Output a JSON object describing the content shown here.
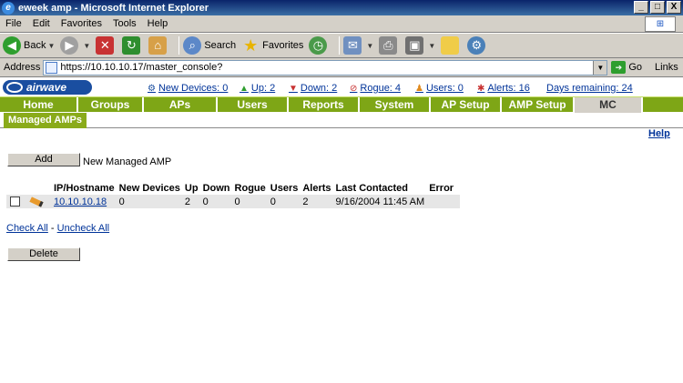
{
  "window": {
    "title": "eweek amp - Microsoft Internet Explorer",
    "controls": [
      "_",
      "□",
      "X"
    ]
  },
  "menu": [
    "File",
    "Edit",
    "Favorites",
    "Tools",
    "Help"
  ],
  "toolbar": {
    "back": "Back",
    "search": "Search",
    "favorites": "Favorites"
  },
  "address": {
    "label": "Address",
    "url": "https://10.10.10.17/master_console?",
    "go": "Go",
    "links": "Links"
  },
  "app": {
    "logo": "airwave",
    "status": {
      "new_devices": "New Devices: 0",
      "up": "Up: 2",
      "down": "Down: 2",
      "rogue": "Rogue: 4",
      "users": "Users: 0",
      "alerts": "Alerts: 16",
      "days_remaining": "Days remaining: 24"
    },
    "nav": [
      "Home",
      "Groups",
      "APs",
      "Users",
      "Reports",
      "System",
      "AP Setup",
      "AMP Setup",
      "MC"
    ],
    "active_nav": "MC",
    "subtab": "Managed AMPs",
    "help": "Help",
    "add_button": "Add",
    "add_label": "New Managed AMP",
    "table": {
      "headers": [
        "IP/Hostname",
        "New Devices",
        "Up",
        "Down",
        "Rogue",
        "Users",
        "Alerts",
        "Last Contacted",
        "Error"
      ],
      "rows": [
        {
          "ip": "10.10.10.18",
          "new_devices": "0",
          "up": "2",
          "down": "0",
          "rogue": "0",
          "users": "0",
          "alerts": "2",
          "last_contacted": "9/16/2004 11:45 AM",
          "error": ""
        }
      ]
    },
    "check_all": "Check All",
    "check_sep": "-",
    "uncheck_all": "Uncheck All",
    "delete_button": "Delete"
  },
  "colors": {
    "nav_green": "#7ea616",
    "link_blue": "#003399",
    "title_blue": "#0a246a"
  }
}
